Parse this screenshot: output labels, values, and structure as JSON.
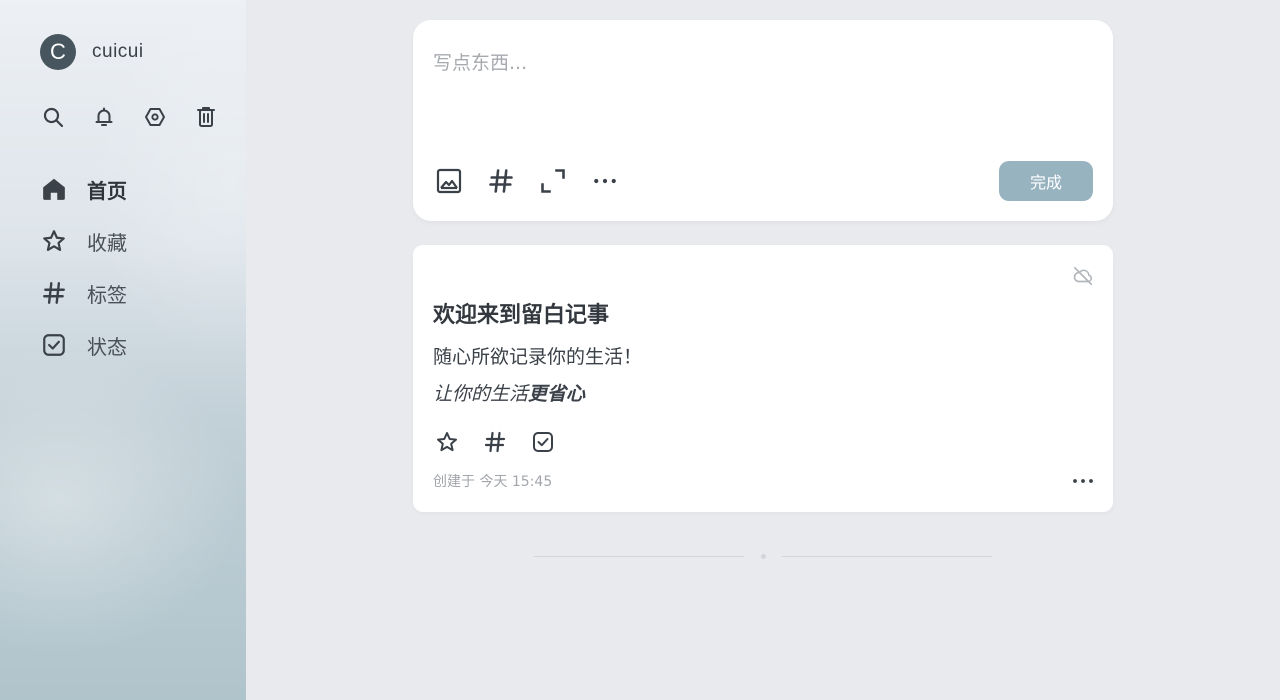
{
  "sidebar": {
    "user": {
      "avatar_letter": "C",
      "name": "cuicui"
    },
    "tools": [
      {
        "icon": "search-icon"
      },
      {
        "icon": "bell-icon"
      },
      {
        "icon": "settings-hexagon-icon"
      },
      {
        "icon": "trash-icon"
      }
    ],
    "nav": [
      {
        "label": "首页",
        "icon": "home-icon",
        "active": true
      },
      {
        "label": "收藏",
        "icon": "star-icon"
      },
      {
        "label": "标签",
        "icon": "hash-icon"
      },
      {
        "label": "状态",
        "icon": "check-square-icon"
      }
    ]
  },
  "editor": {
    "placeholder": "写点东西...",
    "tools": [
      "image-icon",
      "hash-icon",
      "expand-icon",
      "more-horizontal-icon"
    ],
    "done_label": "完成"
  },
  "note": {
    "title": "欢迎来到留白记事",
    "line1": "随心所欲记录你的生活！",
    "line2_italic": "让你的生活",
    "line2_bold": "更省心",
    "meta": "创建于 今天 15:45",
    "sync_icon": "cloud-off-icon",
    "actions": [
      "star-icon",
      "hash-icon",
      "check-square-icon"
    ]
  },
  "colors": {
    "accent_button": "#98b3c0",
    "avatar_bg": "#47555f",
    "text_primary": "#3b4148",
    "page_bg": "#e8eaed"
  }
}
